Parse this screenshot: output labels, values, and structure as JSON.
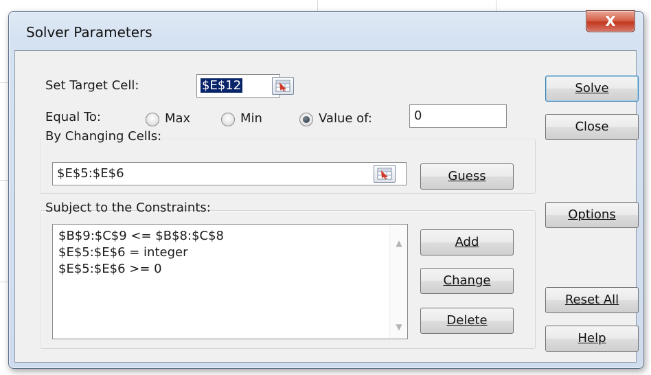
{
  "window": {
    "title": "Solver Parameters",
    "close_glyph": "X"
  },
  "target": {
    "label": "Set Target Cell:",
    "value": "$E$12"
  },
  "equal_to": {
    "label": "Equal To:",
    "options": [
      {
        "name": "max",
        "label": "Max",
        "selected": false
      },
      {
        "name": "min",
        "label": "Min",
        "selected": false
      },
      {
        "name": "value-of",
        "label": "Value of:",
        "selected": true
      }
    ],
    "value": "0"
  },
  "changing": {
    "label": "By Changing Cells:",
    "value": "$E$5:$E$6",
    "guess_label": "Guess"
  },
  "constraints": {
    "label": "Subject to the Constraints:",
    "items": [
      "$B$9:$C$9 <= $B$8:$C$8",
      "$E$5:$E$6 = integer",
      "$E$5:$E$6 >= 0"
    ],
    "add_label": "Add",
    "change_label": "Change",
    "delete_label": "Delete"
  },
  "side": {
    "solve_label": "Solve",
    "close_label": "Close",
    "options_label": "Options",
    "reset_label": "Reset All",
    "help_label": "Help"
  },
  "icons": {
    "ref": "cell-reference-picker-icon",
    "scroll_up": "scroll-up-icon",
    "scroll_down": "scroll-down-icon"
  }
}
